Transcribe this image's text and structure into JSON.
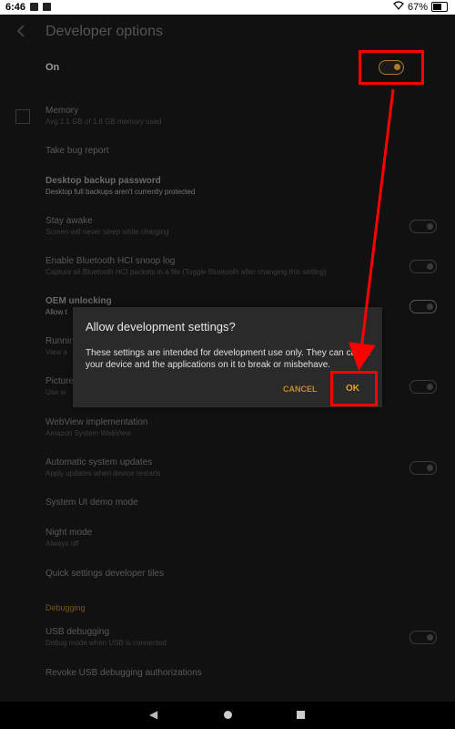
{
  "status_bar": {
    "time": "6:46",
    "battery": "67%"
  },
  "header": {
    "title": "Developer options",
    "back_icon": "chevron-left-icon"
  },
  "master_switch": {
    "label": "On"
  },
  "settings": [
    {
      "title": "Memory",
      "subtitle": "Avg 1.1 GB of 1.8 GB memory used"
    },
    {
      "title": "Take bug report",
      "subtitle": ""
    },
    {
      "title": "Desktop backup password",
      "subtitle": "Desktop full backups aren't currently protected"
    },
    {
      "title": "Stay awake",
      "subtitle": "Screen will never sleep while charging"
    },
    {
      "title": "Enable Bluetooth HCI snoop log",
      "subtitle": "Capture all Bluetooth HCI packets in a file (Toggle Bluetooth after changing this setting)"
    },
    {
      "title": "OEM unlocking",
      "subtitle": "Allow t"
    },
    {
      "title": "Runnin",
      "subtitle": "View a"
    },
    {
      "title": "Picture",
      "subtitle": "Use w"
    },
    {
      "title": "WebView implementation",
      "subtitle": "Amazon System WebView"
    },
    {
      "title": "Automatic system updates",
      "subtitle": "Apply updates when device restarts"
    },
    {
      "title": "System UI demo mode",
      "subtitle": ""
    },
    {
      "title": "Night mode",
      "subtitle": "Always off"
    },
    {
      "title": "Quick settings developer tiles",
      "subtitle": ""
    },
    {
      "title": "USB debugging",
      "subtitle": "Debug mode when USB is connected"
    },
    {
      "title": "Revoke USB debugging authorizations",
      "subtitle": ""
    }
  ],
  "section": {
    "debugging": "Debugging"
  },
  "dialog": {
    "title": "Allow development settings?",
    "body": "These settings are intended for development use only. They can cause your device and the applications on it to break or misbehave.",
    "cancel": "CANCEL",
    "ok": "OK"
  },
  "colors": {
    "accent": "#e2a12f",
    "highlight": "#ff0000"
  }
}
